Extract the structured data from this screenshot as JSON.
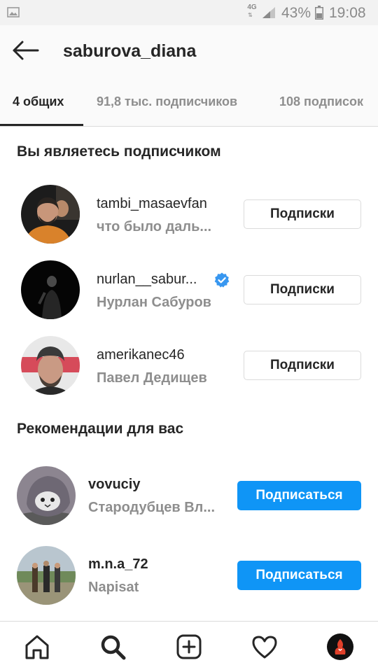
{
  "status_bar": {
    "network": "4G",
    "battery_percent": "43%",
    "time": "19:08"
  },
  "header": {
    "title": "saburova_diana",
    "back_icon": "arrow-left-icon"
  },
  "tabs": [
    {
      "label": "4 общих",
      "active": true
    },
    {
      "label": "91,8 тыс. подписчиков",
      "active": false
    },
    {
      "label": "108 подписок",
      "active": false
    }
  ],
  "following_section": {
    "title": "Вы являетесь подписчиком",
    "users": [
      {
        "username": "tambi_masaevfan",
        "subtitle": "что было даль...",
        "verified": false,
        "button": "Подписки"
      },
      {
        "username": "nurlan__sabur...",
        "subtitle": "Нурлан Сабуров",
        "verified": true,
        "button": "Подписки"
      },
      {
        "username": "amerikanec46",
        "subtitle": "Павел Дедищев",
        "verified": false,
        "button": "Подписки"
      }
    ]
  },
  "recommendations_section": {
    "title": "Рекомендации для вас",
    "users": [
      {
        "username": "vovuciy",
        "subtitle": "Стародубцев Вл...",
        "button": "Подписаться"
      },
      {
        "username": "m.n.a_72",
        "subtitle": "Napisat",
        "button": "Подписаться"
      }
    ]
  },
  "bottom_nav": [
    "home-icon",
    "search-icon",
    "add-post-icon",
    "activity-heart-icon",
    "profile-avatar"
  ],
  "colors": {
    "accent": "#0f95f6",
    "verified": "#3897f0",
    "text_primary": "#262626",
    "text_secondary": "#8e8e8e",
    "border": "#dbdbdb"
  }
}
